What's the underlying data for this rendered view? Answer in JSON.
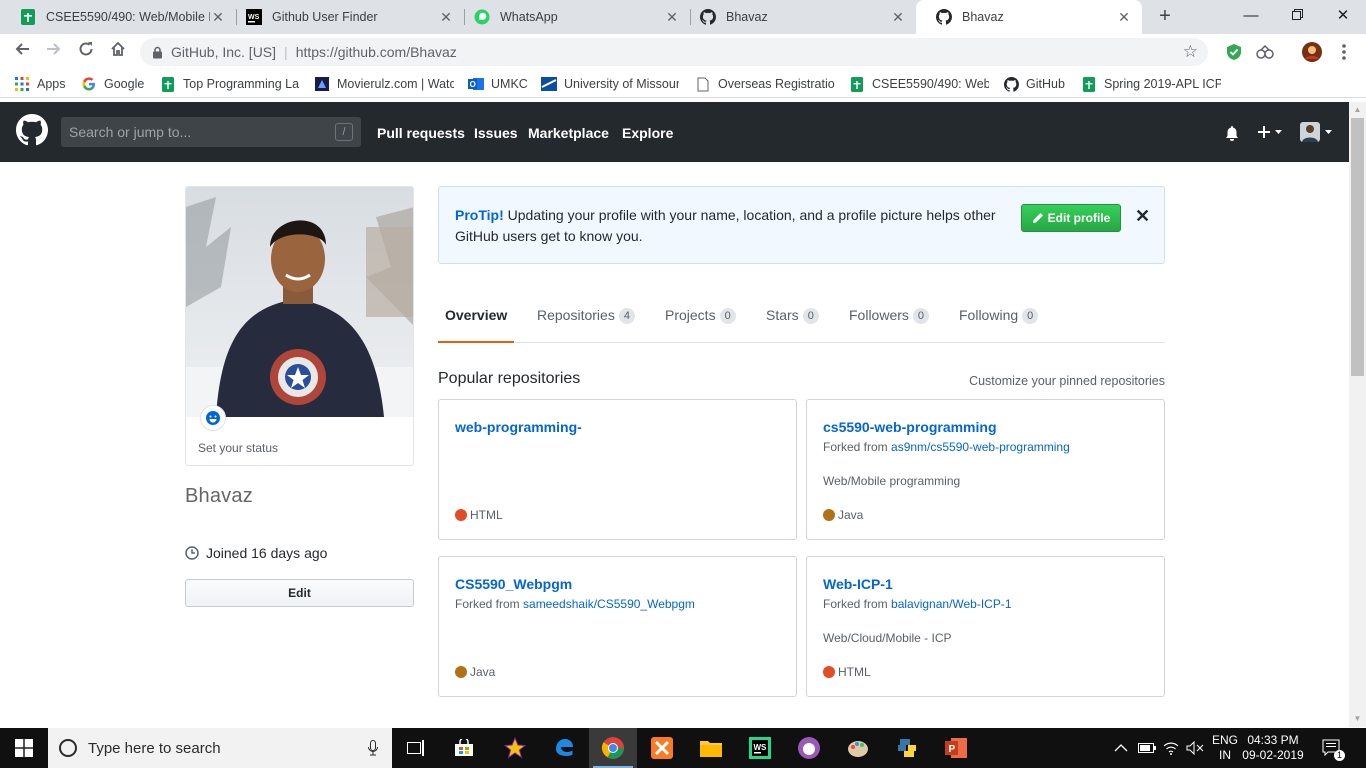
{
  "browser": {
    "tabs": [
      {
        "title": "CSEE5590/490: Web/Mobile Pr",
        "icon": "sheets-icon"
      },
      {
        "title": "Github User Finder",
        "icon": "webstorm-icon"
      },
      {
        "title": "WhatsApp",
        "icon": "whatsapp-icon"
      },
      {
        "title": "Bhavaz",
        "icon": "github-icon"
      },
      {
        "title": "Bhavaz",
        "icon": "github-icon",
        "active": true
      }
    ],
    "omnibox": {
      "org": "GitHub, Inc. [US]",
      "url": "https://github.com/Bhavaz"
    },
    "bookmarks": [
      {
        "label": "Apps",
        "icon": "apps-grid-icon"
      },
      {
        "label": "Google",
        "icon": "google-icon"
      },
      {
        "label": "Top Programming La",
        "icon": "sheets-icon"
      },
      {
        "label": "Movierulz.com | Watc",
        "icon": "movie-icon"
      },
      {
        "label": "UMKC",
        "icon": "outlook-icon"
      },
      {
        "label": "University of Missour",
        "icon": "university-icon"
      },
      {
        "label": "Overseas Registration",
        "icon": "page-icon"
      },
      {
        "label": "CSEE5590/490: Web/",
        "icon": "sheets-icon"
      },
      {
        "label": "GitHub",
        "icon": "github-icon"
      },
      {
        "label": "Spring 2019-APL ICP",
        "icon": "sheets-icon"
      }
    ]
  },
  "header": {
    "search_placeholder": "Search or jump to...",
    "search_shortcut": "/",
    "nav": [
      "Pull requests",
      "Issues",
      "Marketplace",
      "Explore"
    ]
  },
  "profile": {
    "status_text": "Set your status",
    "username": "Bhavaz",
    "joined": "Joined 16 days ago",
    "edit_label": "Edit"
  },
  "protip": {
    "title": "ProTip!",
    "text": " Updating your profile with your name, location, and a profile picture helps other GitHub users get to know you.",
    "button": "Edit profile",
    "close": "✕"
  },
  "tabs": [
    {
      "label": "Overview",
      "count": null,
      "selected": true
    },
    {
      "label": "Repositories",
      "count": "4"
    },
    {
      "label": "Projects",
      "count": "0"
    },
    {
      "label": "Stars",
      "count": "0"
    },
    {
      "label": "Followers",
      "count": "0"
    },
    {
      "label": "Following",
      "count": "0"
    }
  ],
  "popular": {
    "heading": "Popular repositories",
    "customize": "Customize your pinned repositories",
    "repos": [
      {
        "name": "web-programming-",
        "fork_prefix": "",
        "fork_src": "",
        "desc": "",
        "lang": "HTML",
        "lang_color": "#e34c26"
      },
      {
        "name": "cs5590-web-programming",
        "fork_prefix": "Forked from ",
        "fork_src": "as9nm/cs5590-web-programming",
        "desc": "Web/Mobile programming",
        "lang": "Java",
        "lang_color": "#b07219"
      },
      {
        "name": "CS5590_Webpgm",
        "fork_prefix": "Forked from ",
        "fork_src": "sameedshaik/CS5590_Webpgm",
        "desc": "",
        "lang": "Java",
        "lang_color": "#b07219"
      },
      {
        "name": "Web-ICP-1",
        "fork_prefix": "Forked from ",
        "fork_src": "balavignan/Web-ICP-1",
        "desc": "Web/Cloud/Mobile - ICP",
        "lang": "HTML",
        "lang_color": "#e34c26"
      }
    ]
  },
  "taskbar": {
    "search_placeholder": "Type here to search",
    "lang_top": "ENG",
    "lang_bottom": "IN",
    "time": "04:33 PM",
    "date": "09-02-2019",
    "notification_count": "1"
  },
  "colors": {
    "accent": "#0366d6",
    "header_bg": "#24292e",
    "tab_underline": "#e36209",
    "green": "#28a745"
  }
}
